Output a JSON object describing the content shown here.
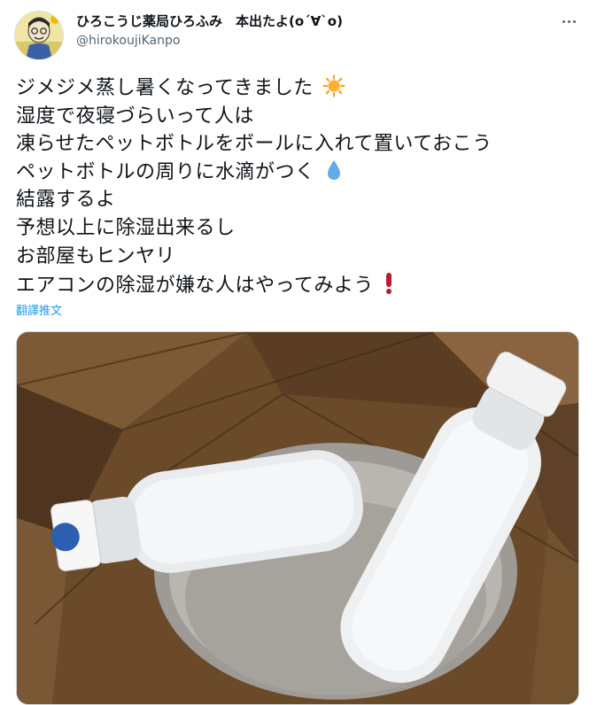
{
  "user": {
    "display_name": "ひろこうじ薬局ひろふみ　本出たよ(o´∀`o)",
    "handle": "@hirokoujiKanpo"
  },
  "tweet": {
    "lines": [
      "ジメジメ蒸し暑くなってきました",
      "湿度で夜寝づらいって人は",
      "凍らせたペットボトルをボールに入れて置いておこう",
      "ペットボトルの周りに水滴がつく",
      "結露するよ",
      "予想以上に除湿出来るし",
      "お部屋もヒンヤリ",
      "エアコンの除湿が嫌な人はやってみよう"
    ],
    "emoji_icons": [
      "sun-icon",
      "water-drop-icon",
      "exclamation-icon"
    ]
  },
  "translate_label": "翻譯推文",
  "media": {
    "description_icon": "photo-frozen-bottles"
  },
  "colors": {
    "link": "#1d9bf0",
    "secondary_text": "#536471",
    "wood": "#6b4a2a",
    "bowl": "#a8a4a0"
  }
}
